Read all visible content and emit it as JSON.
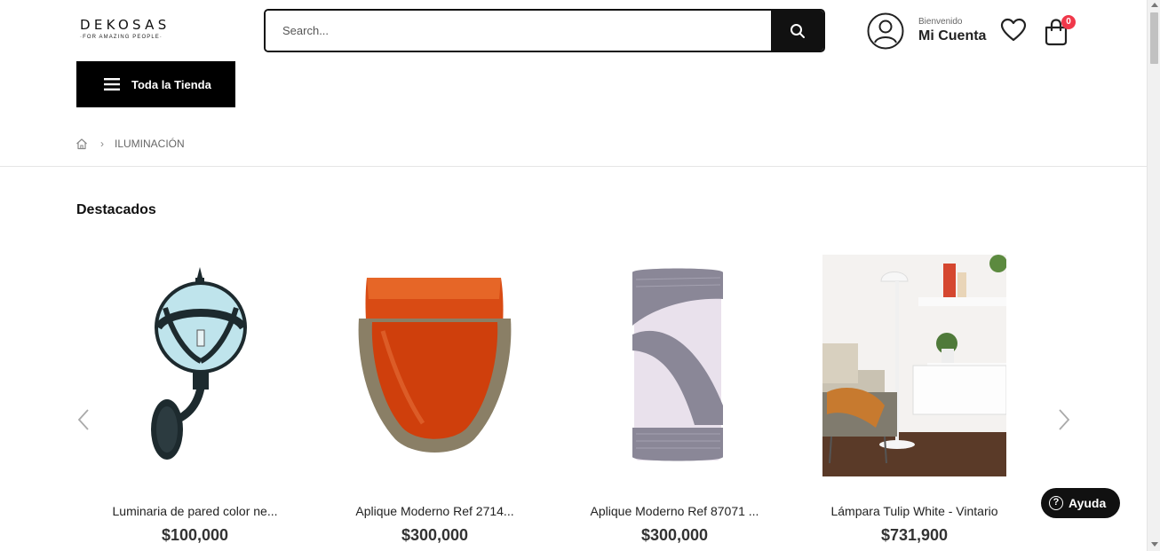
{
  "header": {
    "logo_main": "DEKOSAS",
    "logo_sub": "·FOR AMAZING PEOPLE·",
    "search_placeholder": "Search...",
    "account_small": "Bienvenido",
    "account_big": "Mi Cuenta",
    "cart_count": "0",
    "accent_color": "#f0384a"
  },
  "nav": {
    "store_label": "Toda la Tienda"
  },
  "breadcrumb": {
    "home_icon": "home-icon",
    "current": "ILUMINACIÓN"
  },
  "section": {
    "title": "Destacados"
  },
  "products": [
    {
      "name": "Luminaria de pared color ne...",
      "price": "$100,000"
    },
    {
      "name": "Aplique Moderno Ref 2714...",
      "price": "$300,000"
    },
    {
      "name": "Aplique Moderno Ref 87071 ...",
      "price": "$300,000"
    },
    {
      "name": "Lámpara Tulip White - Vintario",
      "price": "$731,900"
    }
  ],
  "help": {
    "label": "Ayuda"
  }
}
